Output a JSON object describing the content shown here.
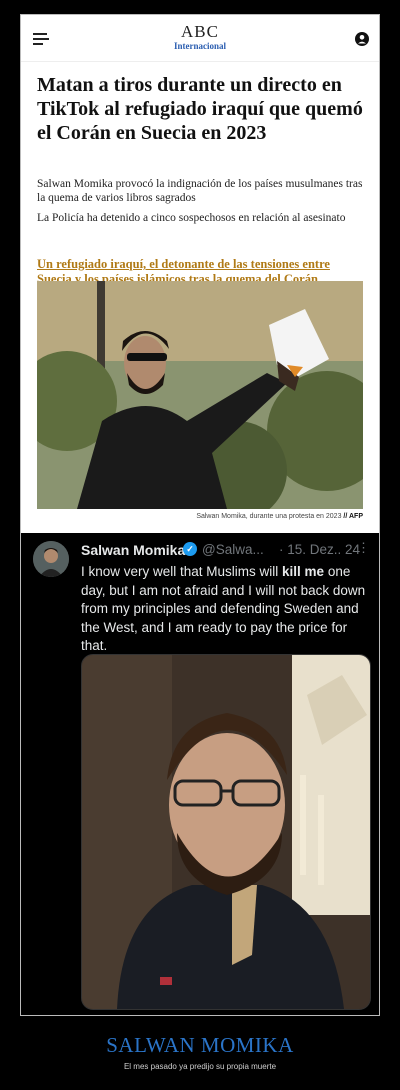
{
  "header": {
    "logo": "ABC",
    "edition": "Internacional",
    "menu_icon": "hamburger-menu-icon",
    "user_icon": "user-account-icon"
  },
  "article": {
    "headline": "Matan a tiros durante un directo en TikTok al refugiado iraquí que quemó el Corán en Suecia en 2023",
    "paragraphs": [
      "Salwan Momika provocó la indignación de los países musulmanes tras la quema de varios libros sagrados",
      "La Policía ha detenido a cinco sospechosos en relación al asesinato"
    ],
    "related_link": "Un refugiado iraquí, el detonante de las tensiones entre Suecia y los países islámicos tras la quema del Corán",
    "photo_caption": "Salwan Momika, durante una protesta en 2023",
    "photo_credit": "// AFP"
  },
  "tweet": {
    "name": "Salwan Momika",
    "handle": "@Salwa...",
    "date": "· 15. Dez.. 24",
    "more": "⋮",
    "text_before": "I know very well that Muslims will ",
    "text_bold": "kill me",
    "text_after": " one day, but I am not afraid and I will not back down from my principles and defending Sweden and the West, and I am ready to pay the price for that."
  },
  "footer": {
    "title": "SALWAN MOMIKA",
    "subtitle": "El mes pasado ya predijo su propia muerte"
  },
  "colors": {
    "link": "#b07a16",
    "verified": "#1d9bf0",
    "footer_title": "#2a74c8"
  }
}
